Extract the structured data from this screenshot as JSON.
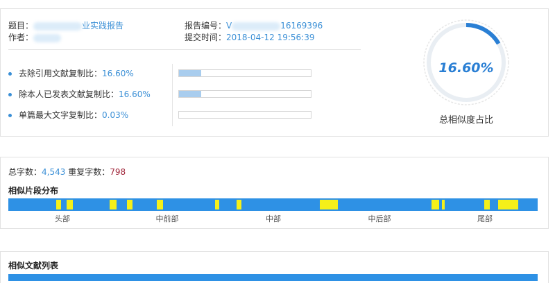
{
  "report": {
    "title_label": "题目：",
    "title_value": "业实践报告",
    "author_label": "作者：",
    "number_label": "报告编号：",
    "number_value_prefix": "V",
    "number_value": "16169396",
    "submit_label": "提交时间：",
    "submit_value": "2018-04-12 19:56:39"
  },
  "stats": [
    {
      "label": "去除引用文献复制比：",
      "value": "16.60%",
      "fraction": 0.166
    },
    {
      "label": "除本人已发表文献复制比：",
      "value": "16.60%",
      "fraction": 0.166
    },
    {
      "label": "单篇最大文字复制比：",
      "value": "0.03%",
      "fraction": 0.0003
    }
  ],
  "gauge": {
    "value": "16.60%",
    "fraction": 0.166,
    "label": "总相似度占比",
    "color": "#2a7fd4"
  },
  "counts": {
    "total_label": "总字数：",
    "total_value": "4,543",
    "repeat_label": "重复字数：",
    "repeat_value": "798"
  },
  "distribution": {
    "title": "相似片段分布",
    "base_color": "#2e91e5",
    "highlight_color": "#f5f01a",
    "segments": [
      {
        "start": 0.091,
        "end": 0.099
      },
      {
        "start": 0.11,
        "end": 0.122
      },
      {
        "start": 0.192,
        "end": 0.204
      },
      {
        "start": 0.224,
        "end": 0.234
      },
      {
        "start": 0.28,
        "end": 0.292
      },
      {
        "start": 0.391,
        "end": 0.399
      },
      {
        "start": 0.431,
        "end": 0.441
      },
      {
        "start": 0.588,
        "end": 0.623
      },
      {
        "start": 0.799,
        "end": 0.814
      },
      {
        "start": 0.819,
        "end": 0.824
      },
      {
        "start": 0.899,
        "end": 0.909
      },
      {
        "start": 0.925,
        "end": 0.963
      }
    ],
    "positions": [
      "头部",
      "中前部",
      "中部",
      "中后部",
      "尾部"
    ]
  },
  "similar_list": {
    "title": "相似文献列表"
  }
}
